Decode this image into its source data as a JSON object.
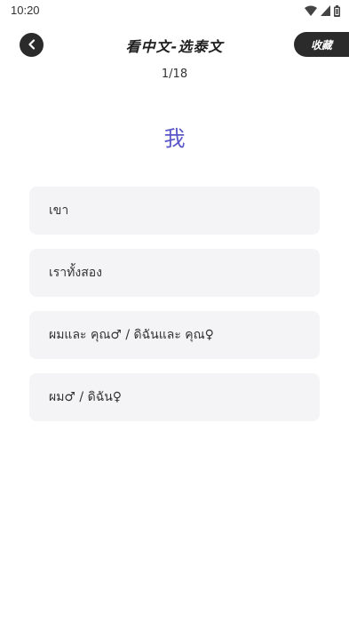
{
  "status_bar": {
    "time": "10:20",
    "icons": [
      "wifi-icon",
      "cellular-icon",
      "battery-icon"
    ]
  },
  "header": {
    "title": "看中文-选泰文",
    "favorite_label": "收藏",
    "back_icon": "chevron-left-icon"
  },
  "progress": "1/18",
  "question": "我",
  "options": [
    {
      "label": "เขา"
    },
    {
      "label": "เราทั้งสอง"
    },
    {
      "label": "ผมและ คุณ♂ / ดิฉันและ คุณ♀"
    },
    {
      "label": "ผม♂ / ดิฉัน♀"
    }
  ],
  "colors": {
    "accent": "#5a57c8",
    "dark_button": "#2b2b2b",
    "option_bg": "#f4f4f7"
  }
}
